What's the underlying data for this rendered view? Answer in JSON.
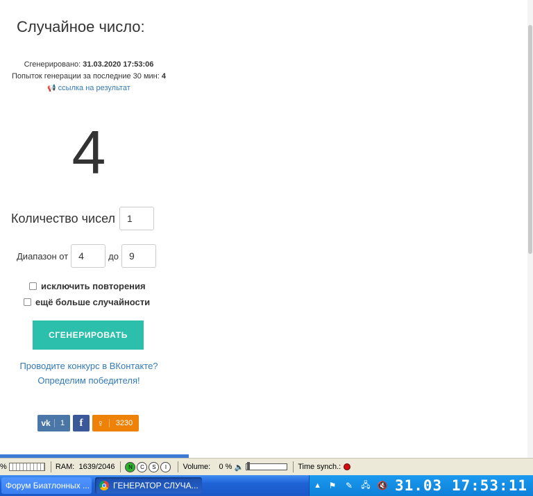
{
  "page": {
    "title": "Случайное число:",
    "generated_label": "Сгенерировано:",
    "generated_value": "31.03.2020 17:53:06",
    "attempts_label": "Попыток генерации за последние 30 мин:",
    "attempts_value": "4",
    "result_link": "ссылка на результат",
    "result_number": "4",
    "count_label": "Количество чисел",
    "count_value": "1",
    "range_label": "Диапазон от",
    "range_from": "4",
    "range_to_label": "до",
    "range_to": "9",
    "checkbox_no_repeat": "исключить повторения",
    "checkbox_more_random": "ещё больше случайности",
    "generate_button": "СГЕНЕРИРОВАТЬ",
    "vk_line1": "Проводите конкурс в ВКонтакте?",
    "vk_line2": "Определим победителя!",
    "share": {
      "vk_icon": "vk",
      "vk_count": "1",
      "fb_icon": "f",
      "ok_count": "3230"
    }
  },
  "statusbar": {
    "percent_label": "%",
    "ram_label": "RAM:",
    "ram_value": "1639/2046",
    "indicators": [
      "N",
      "C",
      "S",
      "I"
    ],
    "volume_label": "Volume:",
    "volume_value": "0 %",
    "timesync_label": "Time synch.:"
  },
  "taskbar": {
    "task1": "Форум Биатлонных ...",
    "task2": "ГЕНЕРАТОР СЛУЧА...",
    "clock": "31.03 17:53:11"
  },
  "colors": {
    "generate_button": "#2cbfab",
    "link": "#337ab7",
    "vk": "#4a76a8",
    "facebook": "#3b5998",
    "odnoklassniki": "#ee8208",
    "taskbar": "#1e63d6"
  }
}
